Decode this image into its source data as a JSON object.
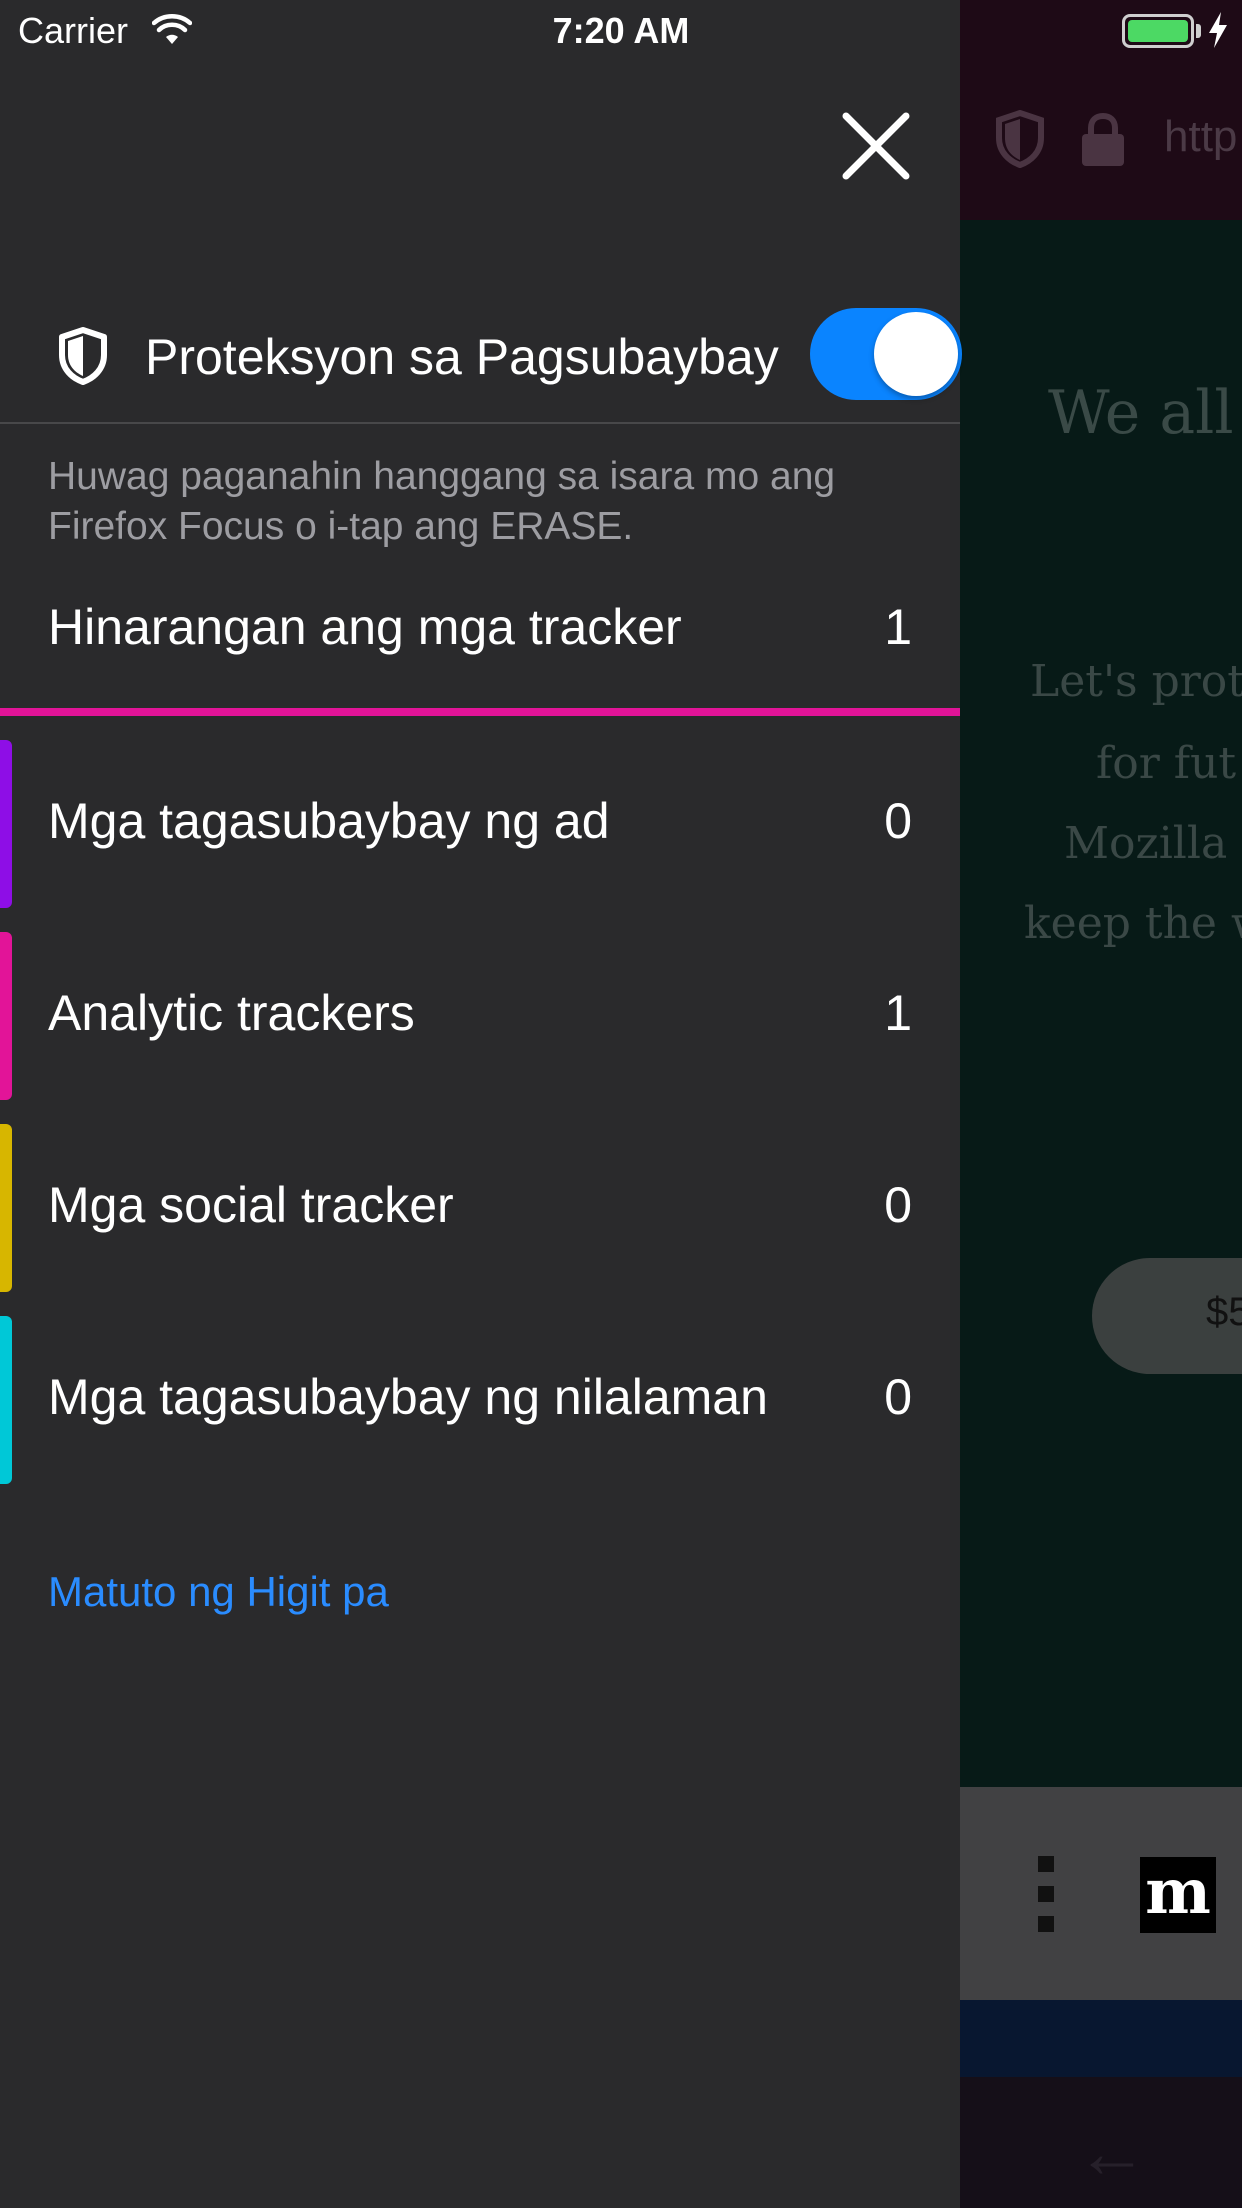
{
  "status_bar": {
    "carrier": "Carrier",
    "time": "7:20 AM",
    "battery_level": 1.0
  },
  "panel": {
    "close_icon": "close-icon",
    "tracking_protection": {
      "icon": "shield-icon",
      "title": "Proteksyon sa Pagsubaybay",
      "toggle_on": true,
      "description": "Huwag paganahin hanggang sa isara mo ang Firefox Focus o i-tap ang ERASE."
    },
    "blocked": {
      "label": "Hinarangan ang mga tracker",
      "count": "1",
      "bar_color": "#e21498"
    },
    "trackers": [
      {
        "label": "Mga tagasubaybay ng ad",
        "count": "0",
        "color": "#8e0ee6"
      },
      {
        "label": "Analytic trackers",
        "count": "1",
        "color": "#e21498"
      },
      {
        "label": "Mga social tracker",
        "count": "0",
        "color": "#d7b600"
      },
      {
        "label": "Mga tagasubaybay ng nilalaman",
        "count": "0",
        "color": "#00c8d7"
      }
    ],
    "learn_more": "Matuto ng Higit pa"
  },
  "background_page": {
    "url_text": "http",
    "headline": "We all",
    "paragraph_lines": [
      "Let's prot",
      "for fut",
      "Mozilla",
      "keep the w"
    ],
    "button_text": "$5",
    "logo_text": "m"
  },
  "colors": {
    "panel_bg": "#2a2a2c",
    "accent_blue": "#0a84ff",
    "link_blue": "#2a8cff"
  }
}
